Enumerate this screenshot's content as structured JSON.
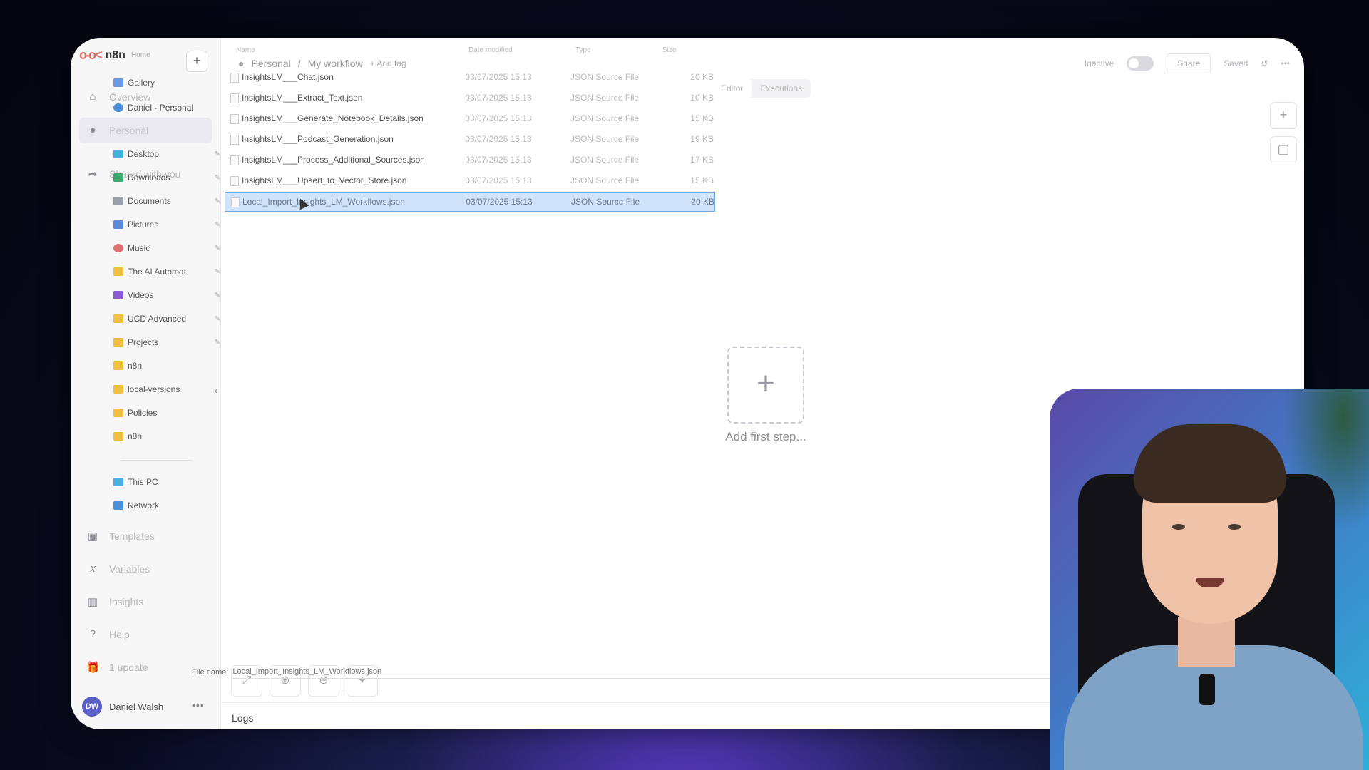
{
  "app": {
    "name": "n8n",
    "home_label": "Home",
    "breadcrumb": {
      "project": "Personal",
      "workflow": "My workflow",
      "add_tag": "+ Add tag"
    },
    "status_label": "Inactive",
    "share_label": "Share",
    "saved_label": "Saved",
    "tabs": [
      {
        "label": "Editor"
      },
      {
        "label": "Executions"
      }
    ],
    "canvas": {
      "add_first_step_label": "Add first step..."
    },
    "logs_label": "Logs"
  },
  "sidebar": {
    "items": [
      {
        "label": "Overview",
        "icon": "home-icon"
      },
      {
        "label": "Personal",
        "icon": "user-icon"
      },
      {
        "label": "Shared with you",
        "icon": "share-icon"
      },
      {
        "label": "Templates",
        "icon": "templates-icon"
      },
      {
        "label": "Variables",
        "icon": "variables-icon"
      },
      {
        "label": "Insights",
        "icon": "chart-icon"
      },
      {
        "label": "Help",
        "icon": "help-icon"
      },
      {
        "label": "1 update",
        "icon": "gift-icon"
      }
    ],
    "user": {
      "initials": "DW",
      "name": "Daniel Walsh"
    }
  },
  "file_dialog": {
    "nav": [
      {
        "label": "Gallery",
        "color": "#6b9be6"
      },
      {
        "label": "Daniel - Personal",
        "color": "#4a90d9"
      },
      {
        "label": "Desktop",
        "color": "#4ab0e0"
      },
      {
        "label": "Downloads",
        "color": "#3aa86a"
      },
      {
        "label": "Documents",
        "color": "#9aa0aa"
      },
      {
        "label": "Pictures",
        "color": "#5a8ad8"
      },
      {
        "label": "Music",
        "color": "#e07070"
      },
      {
        "label": "The AI Automat",
        "color": "#f0c040"
      },
      {
        "label": "Videos",
        "color": "#8a5ad8"
      },
      {
        "label": "UCD Advanced",
        "color": "#f0c040"
      },
      {
        "label": "Projects",
        "color": "#f0c040"
      },
      {
        "label": "n8n",
        "color": "#f0c040"
      },
      {
        "label": "local-versions",
        "color": "#f0c040"
      },
      {
        "label": "Policies",
        "color": "#f0c040"
      },
      {
        "label": "n8n",
        "color": "#f0c040"
      },
      {
        "label": "This PC",
        "color": "#4ab0e0"
      },
      {
        "label": "Network",
        "color": "#4a90d9"
      }
    ],
    "columns": {
      "name": "Name",
      "date": "Date modified",
      "type": "Type",
      "size": "Size"
    },
    "files": [
      {
        "name": "InsightsLM___Chat.json",
        "date": "03/07/2025 15:13",
        "type": "JSON Source File",
        "size": "20 KB"
      },
      {
        "name": "InsightsLM___Extract_Text.json",
        "date": "03/07/2025 15:13",
        "type": "JSON Source File",
        "size": "10 KB"
      },
      {
        "name": "InsightsLM___Generate_Notebook_Details.json",
        "date": "03/07/2025 15:13",
        "type": "JSON Source File",
        "size": "15 KB"
      },
      {
        "name": "InsightsLM___Podcast_Generation.json",
        "date": "03/07/2025 15:13",
        "type": "JSON Source File",
        "size": "19 KB"
      },
      {
        "name": "InsightsLM___Process_Additional_Sources.json",
        "date": "03/07/2025 15:13",
        "type": "JSON Source File",
        "size": "17 KB"
      },
      {
        "name": "InsightsLM___Upsert_to_Vector_Store.json",
        "date": "03/07/2025 15:13",
        "type": "JSON Source File",
        "size": "15 KB"
      },
      {
        "name": "Local_Import_Insights_LM_Workflows.json",
        "date": "03/07/2025 15:13",
        "type": "JSON Source File",
        "size": "20 KB"
      }
    ],
    "file_name_label": "File name:",
    "file_name_value": "Local_Import_Insights_LM_Workflows.json"
  }
}
